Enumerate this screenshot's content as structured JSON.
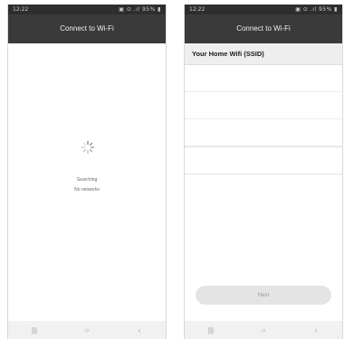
{
  "left_screen": {
    "status_time": "12:22",
    "status_icons": "▣ ⊙ .ıl 95% ▮",
    "title": "Connect to Wi-Fi",
    "searching_text": "Searching",
    "no_networks_text": "No networks"
  },
  "right_screen": {
    "status_time": "12:22",
    "status_icons": "▣ ⊙ .ıl 95% ▮",
    "title": "Connect to Wi-Fi",
    "ssid_header": "Your Home Wifi (SSID)",
    "next_label": "Next"
  },
  "nav": {
    "recent_glyph": "|||",
    "home_glyph": "○",
    "back_glyph": "‹"
  },
  "colors": {
    "status_bar": "#2e2e2e",
    "app_bar": "#3a3a3a",
    "nav_bar": "#f1f1f1",
    "button_bg": "#e4e4e4"
  }
}
